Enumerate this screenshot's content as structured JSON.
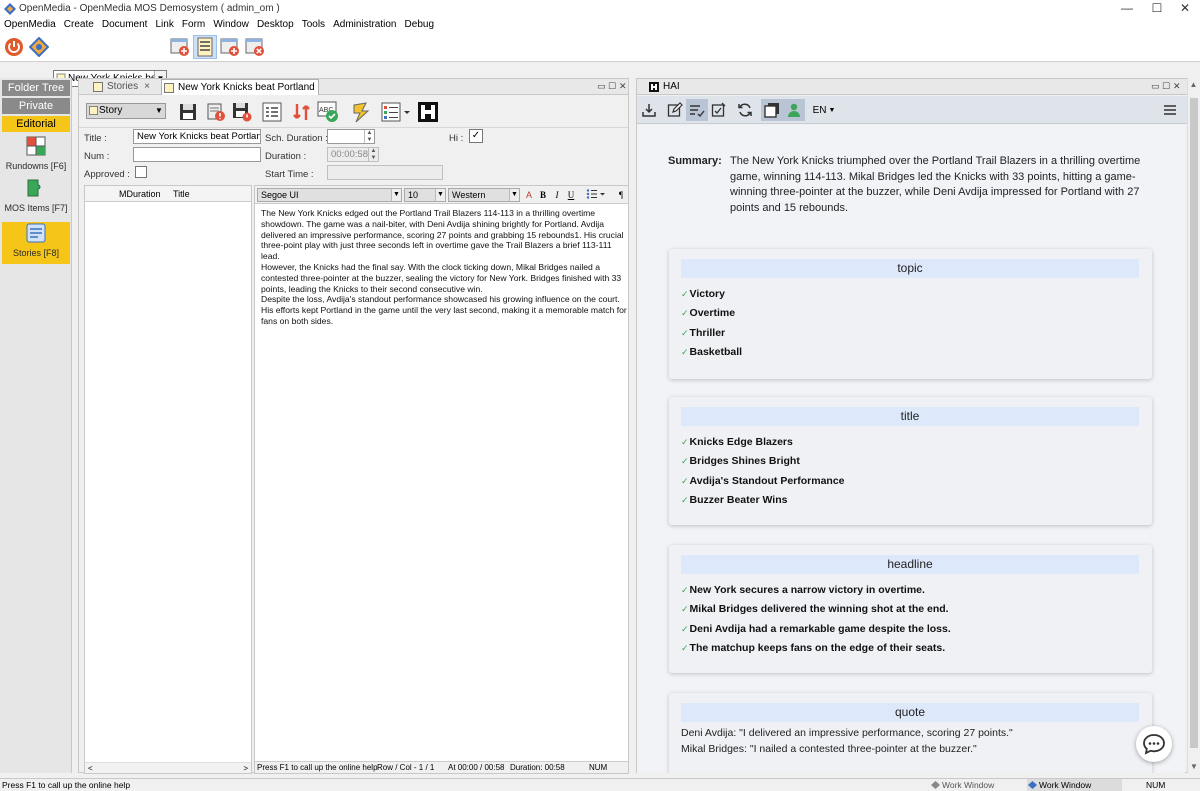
{
  "window": {
    "title": "OpenMedia - OpenMedia MOS Demosystem ( admin_om )",
    "minimize": "—",
    "maximize": "☐",
    "close": "✕"
  },
  "menu": [
    "OpenMedia",
    "Create",
    "Document",
    "Link",
    "Form",
    "Window",
    "Desktop",
    "Tools",
    "Administration",
    "Debug"
  ],
  "toolbar": {
    "story_select": "New York Knicks beat P"
  },
  "left_nav": {
    "folder_tree": "Folder Tree",
    "private_layout": "Private Layou...",
    "editorial": "Editorial",
    "rundowns": "Rundowns [F6]",
    "mos_items": "MOS Items [F7]",
    "stories": "Stories [F8]"
  },
  "stories_panel": {
    "tab_stories": "Stories",
    "tab_story": "New York Knicks beat Portland T...",
    "tab_close": "×",
    "type_select": "Story",
    "labels": {
      "title": "Title :",
      "num": "Num :",
      "approved": "Approved :",
      "sch_duration": "Sch. Duration :",
      "duration": "Duration :",
      "start_time": "Start Time :",
      "hi": "Hi :"
    },
    "values": {
      "title": "New York Knicks beat Portland Tr",
      "num": "",
      "sch_duration": "",
      "duration": "00:00:58",
      "start_time": "",
      "hi_checked": "✓"
    },
    "grid_headers": [
      "MDuration",
      "Title"
    ],
    "font_name": "Segoe UI",
    "font_size": "10",
    "charset": "Western",
    "fmt": {
      "bold": "B",
      "italic": "I",
      "underline": "U",
      "para": "¶"
    },
    "text": [
      "The New York Knicks edged out the Portland Trail Blazers 114-113 in a thrilling overtime showdown. The game was a nail-biter, with Deni Avdija shining brightly for Portland. Avdija delivered an impressive performance, scoring 27 points and grabbing 15 rebounds1. His crucial three-point play with just three seconds left in overtime gave the Trail Blazers a brief 113-111 lead.",
      "However, the Knicks had the final say. With the clock ticking down, Mikal Bridges nailed a contested three-pointer at the buzzer, sealing the victory for New York. Bridges finished with 33 points, leading the Knicks to their second consecutive win.",
      "Despite the loss, Avdija's standout performance showcased his growing influence on the court. His efforts kept Portland in the game until the very last second, making it a memorable match for fans on both sides."
    ],
    "status": {
      "help": "Press F1 to call up the online help",
      "rowcol": "Row / Col - 1 / 1",
      "at": "At 00:00 / 00:58",
      "duration": "Duration: 00:58",
      "num": "NUM"
    }
  },
  "hai_panel": {
    "tab": "HAI",
    "lang": "EN",
    "summary_label": "Summary:",
    "summary": "The New York Knicks triumphed over the Portland Trail Blazers in a thrilling overtime game, winning 114-113. Mikal Bridges led the Knicks with 33 points, hitting a game-winning three-pointer at the buzzer, while Deni Avdija impressed for Portland with 27 points and 15 rebounds.",
    "cards": [
      {
        "header": "topic",
        "items": [
          "Victory",
          "Overtime",
          "Thriller",
          "Basketball"
        ]
      },
      {
        "header": "title",
        "items": [
          "Knicks Edge Blazers",
          "Bridges Shines Bright",
          "Avdija's Standout Performance",
          "Buzzer Beater Wins"
        ]
      },
      {
        "header": "headline",
        "items": [
          "New York secures a narrow victory in overtime.",
          "Mikal Bridges delivered the winning shot at the end.",
          "Deni Avdija had a remarkable game despite the loss.",
          "The matchup keeps fans on the edge of their seats."
        ]
      },
      {
        "header": "quote",
        "lines": [
          "Deni Avdija: \"I delivered an impressive performance, scoring 27 points.\"",
          "Mikal Bridges: \"I nailed a contested three-pointer at the buzzer.\""
        ]
      }
    ],
    "check_glyph": "✓"
  },
  "bottom_bar": {
    "help": "Press F1 to call up the online help",
    "work_window_1": "Work Window",
    "work_window_2": "Work Window",
    "num": "NUM"
  },
  "colors": {
    "accent_yellow": "#f5c518",
    "card_header": "#dde9fb",
    "check_green": "#3aa65a",
    "red_icon": "#e0503a"
  }
}
